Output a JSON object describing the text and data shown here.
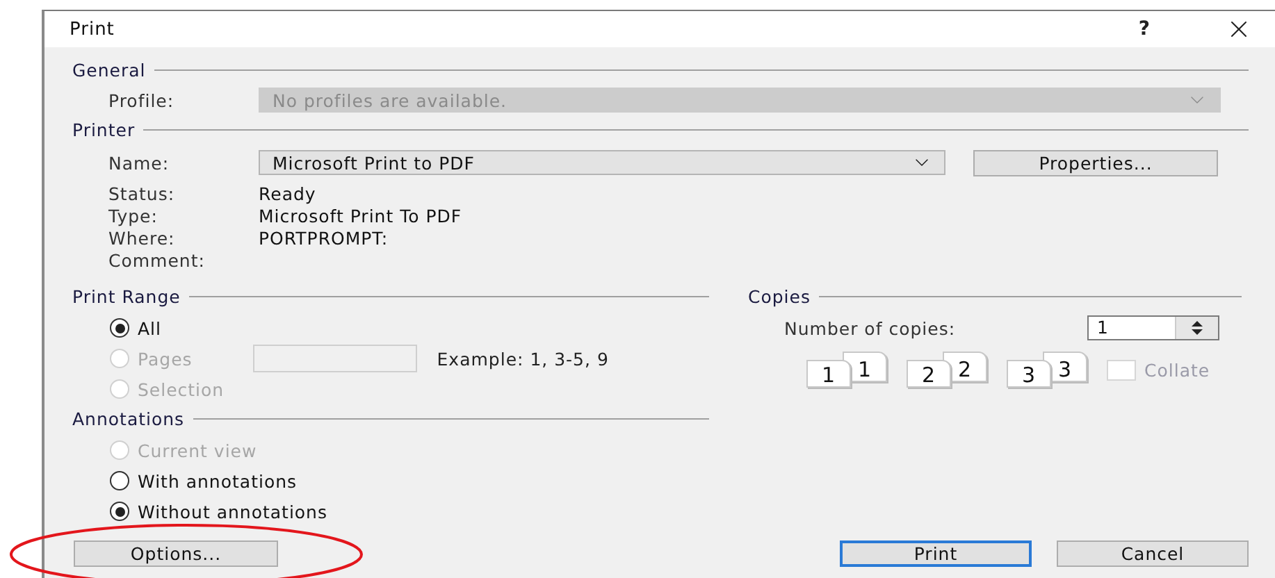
{
  "window": {
    "title": "Print",
    "help": "?"
  },
  "general": {
    "title": "General",
    "profile": {
      "label": "Profile:",
      "value": "No profiles are available.",
      "disabled": true
    }
  },
  "printer": {
    "title": "Printer",
    "name": {
      "label": "Name:",
      "value": "Microsoft Print to PDF",
      "disabled": false
    },
    "properties_button": "Properties...",
    "info": [
      {
        "label": "Status:",
        "value": "Ready"
      },
      {
        "label": "Type:",
        "value": "Microsoft Print To PDF"
      },
      {
        "label": "Where:",
        "value": "PORTPROMPT:"
      },
      {
        "label": "Comment:"
      }
    ]
  },
  "print_range": {
    "title": "Print Range",
    "options": [
      {
        "kind": "plain",
        "label": "All",
        "selected": true,
        "disabled": false
      },
      {
        "kind": "pages",
        "label": "Pages",
        "selected": false,
        "disabled": true
      },
      {
        "kind": "plain",
        "label": "Selection",
        "selected": false,
        "disabled": true
      }
    ],
    "example": "Example: 1, 3-5, 9"
  },
  "annotations": {
    "title": "Annotations",
    "options": [
      {
        "label": "Current view",
        "selected": false,
        "disabled": true
      },
      {
        "label": "With annotations",
        "selected": false,
        "disabled": false
      },
      {
        "label": "Without annotations",
        "selected": true,
        "disabled": false
      }
    ]
  },
  "copies": {
    "title": "Copies",
    "label": "Number of copies:",
    "value": "1",
    "pages": [
      {
        "front": "1",
        "back": "1"
      },
      {
        "front": "2",
        "back": "2"
      },
      {
        "front": "3",
        "back": "3"
      }
    ],
    "collate": {
      "label": "Collate",
      "checked": false,
      "disabled": true
    }
  },
  "buttons": [
    {
      "kind": "options",
      "label": "Options...",
      "default": false
    },
    {
      "kind": "action",
      "label": "Print",
      "default": true
    },
    {
      "kind": "action",
      "label": "Cancel",
      "default": false
    }
  ],
  "markup": {
    "kind": "ellipse",
    "color": "#e3161c"
  }
}
